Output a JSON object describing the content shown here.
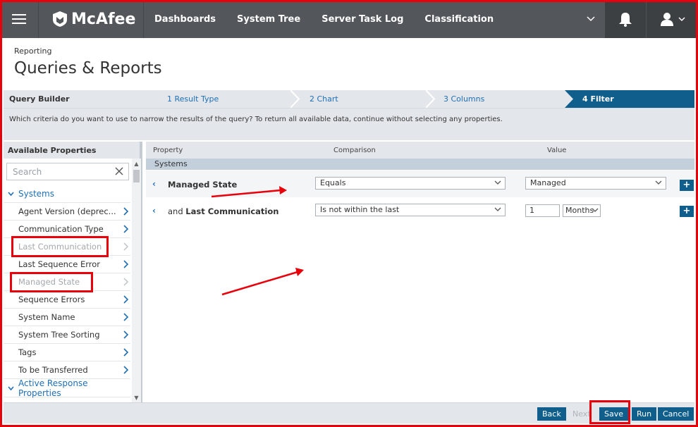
{
  "nav": {
    "brand": "McAfee",
    "items": [
      "Dashboards",
      "System Tree",
      "Server Task Log",
      "Classification"
    ]
  },
  "header": {
    "breadcrumb": "Reporting",
    "title": "Queries & Reports"
  },
  "wizard": {
    "title": "Query Builder",
    "steps": [
      "1 Result Type",
      "2 Chart",
      "3 Columns",
      "4 Filter"
    ],
    "active_step": "4 Filter",
    "instruction": "Which criteria do you want to use to narrow the results of the query? To return all available data, continue without selecting any properties."
  },
  "left_panel": {
    "title": "Available Properties",
    "search_placeholder": "Search",
    "group_systems": "Systems",
    "items": [
      {
        "label": "Agent Version (deprec...",
        "disabled": false
      },
      {
        "label": "Communication Type",
        "disabled": false
      },
      {
        "label": "Last Communication",
        "disabled": true
      },
      {
        "label": "Last Sequence Error",
        "disabled": false
      },
      {
        "label": "Managed State",
        "disabled": true
      },
      {
        "label": "Sequence Errors",
        "disabled": false
      },
      {
        "label": "System Name",
        "disabled": false
      },
      {
        "label": "System Tree Sorting",
        "disabled": false
      },
      {
        "label": "Tags",
        "disabled": false
      },
      {
        "label": "To be Transferred",
        "disabled": false
      }
    ],
    "group_active_response": "Active Response Properties"
  },
  "filter": {
    "col_property": "Property",
    "col_comparison": "Comparison",
    "col_value": "Value",
    "group": "Systems",
    "rows": [
      {
        "prefix": "",
        "property": "Managed State",
        "comparison": "Equals",
        "value": "Managed"
      },
      {
        "prefix": "and",
        "property": "Last Communication",
        "comparison": "Is not within the last",
        "value_number": "1",
        "value_unit": "Months"
      }
    ],
    "add_label": "+"
  },
  "footer": {
    "back": "Back",
    "next": "Next",
    "save": "Save",
    "run": "Run",
    "cancel": "Cancel"
  },
  "colors": {
    "nav_bg": "#53565a",
    "accent": "#0f5e8c",
    "link": "#1f6fb5",
    "annotation": "#e8000b"
  }
}
